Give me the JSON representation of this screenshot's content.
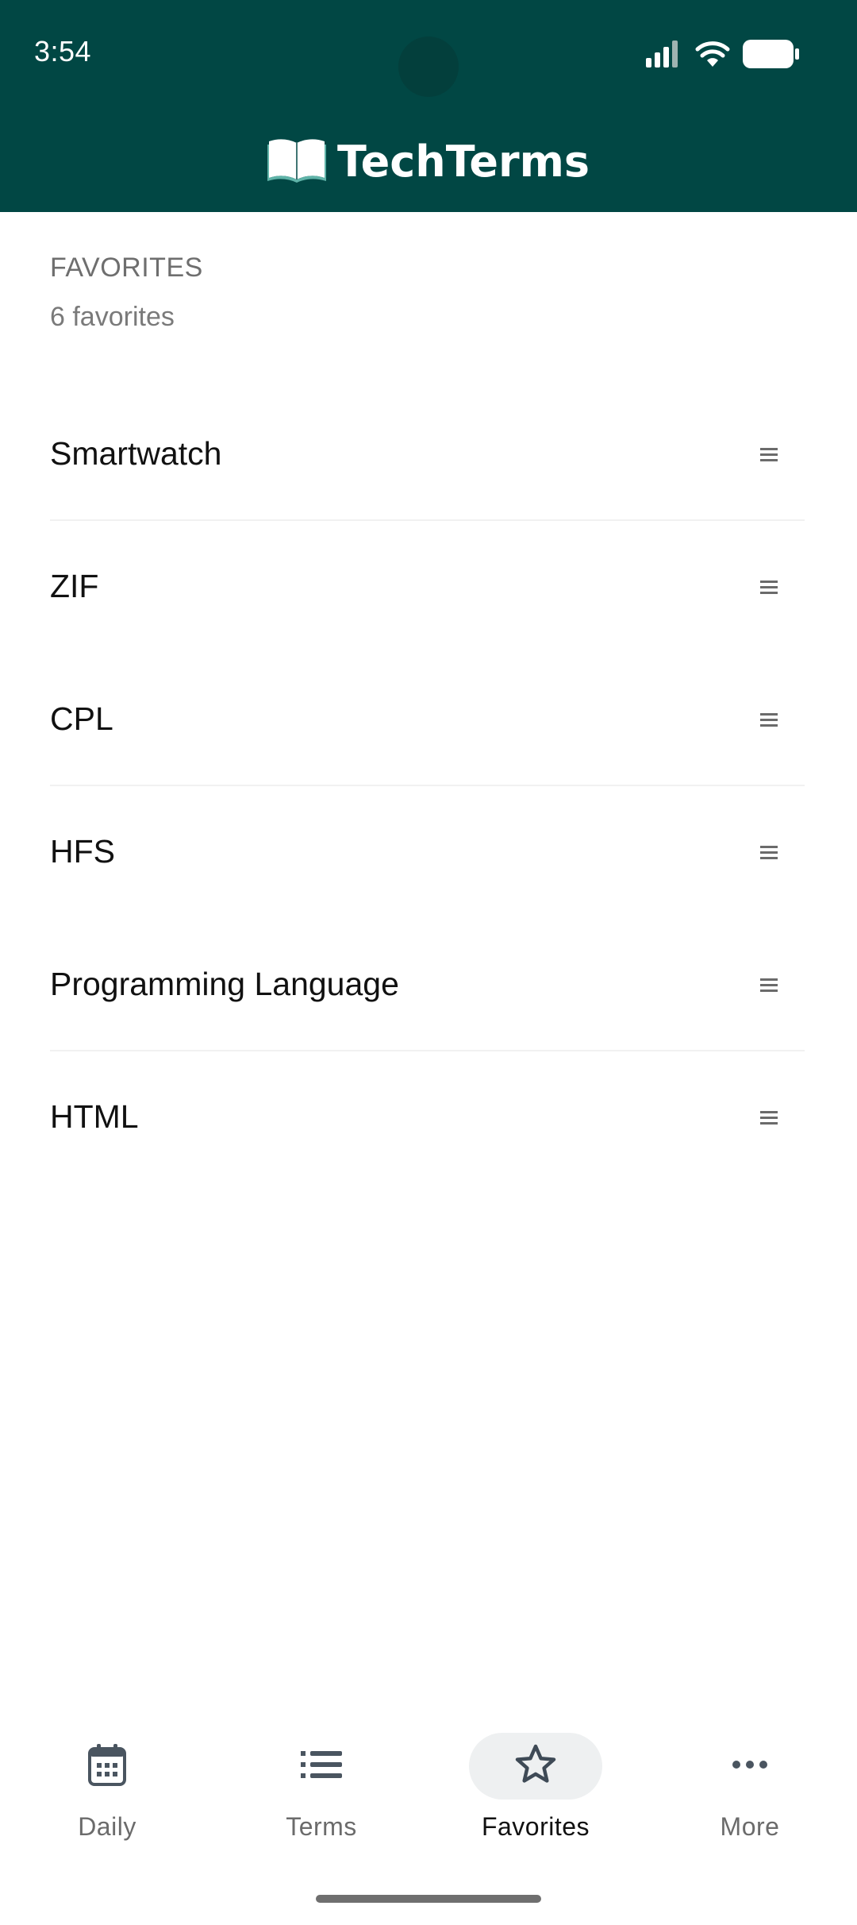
{
  "status_bar": {
    "time": "3:54"
  },
  "app": {
    "title": "TechTerms",
    "brand_color": "#014744",
    "logo_icon": "open-book-icon"
  },
  "favorites": {
    "section_label": "FAVORITES",
    "count_label": "6 favorites",
    "items": [
      {
        "label": "Smartwatch"
      },
      {
        "label": "ZIF"
      },
      {
        "label": "CPL"
      },
      {
        "label": "HFS"
      },
      {
        "label": "Programming Language"
      },
      {
        "label": "HTML"
      }
    ],
    "handle_icon": "drag-handle-icon"
  },
  "bottom_nav": {
    "active": "Favorites",
    "items": [
      {
        "label": "Daily",
        "icon": "calendar-icon"
      },
      {
        "label": "Terms",
        "icon": "list-icon"
      },
      {
        "label": "Favorites",
        "icon": "star-icon"
      },
      {
        "label": "More",
        "icon": "more-horizontal-icon"
      }
    ]
  }
}
